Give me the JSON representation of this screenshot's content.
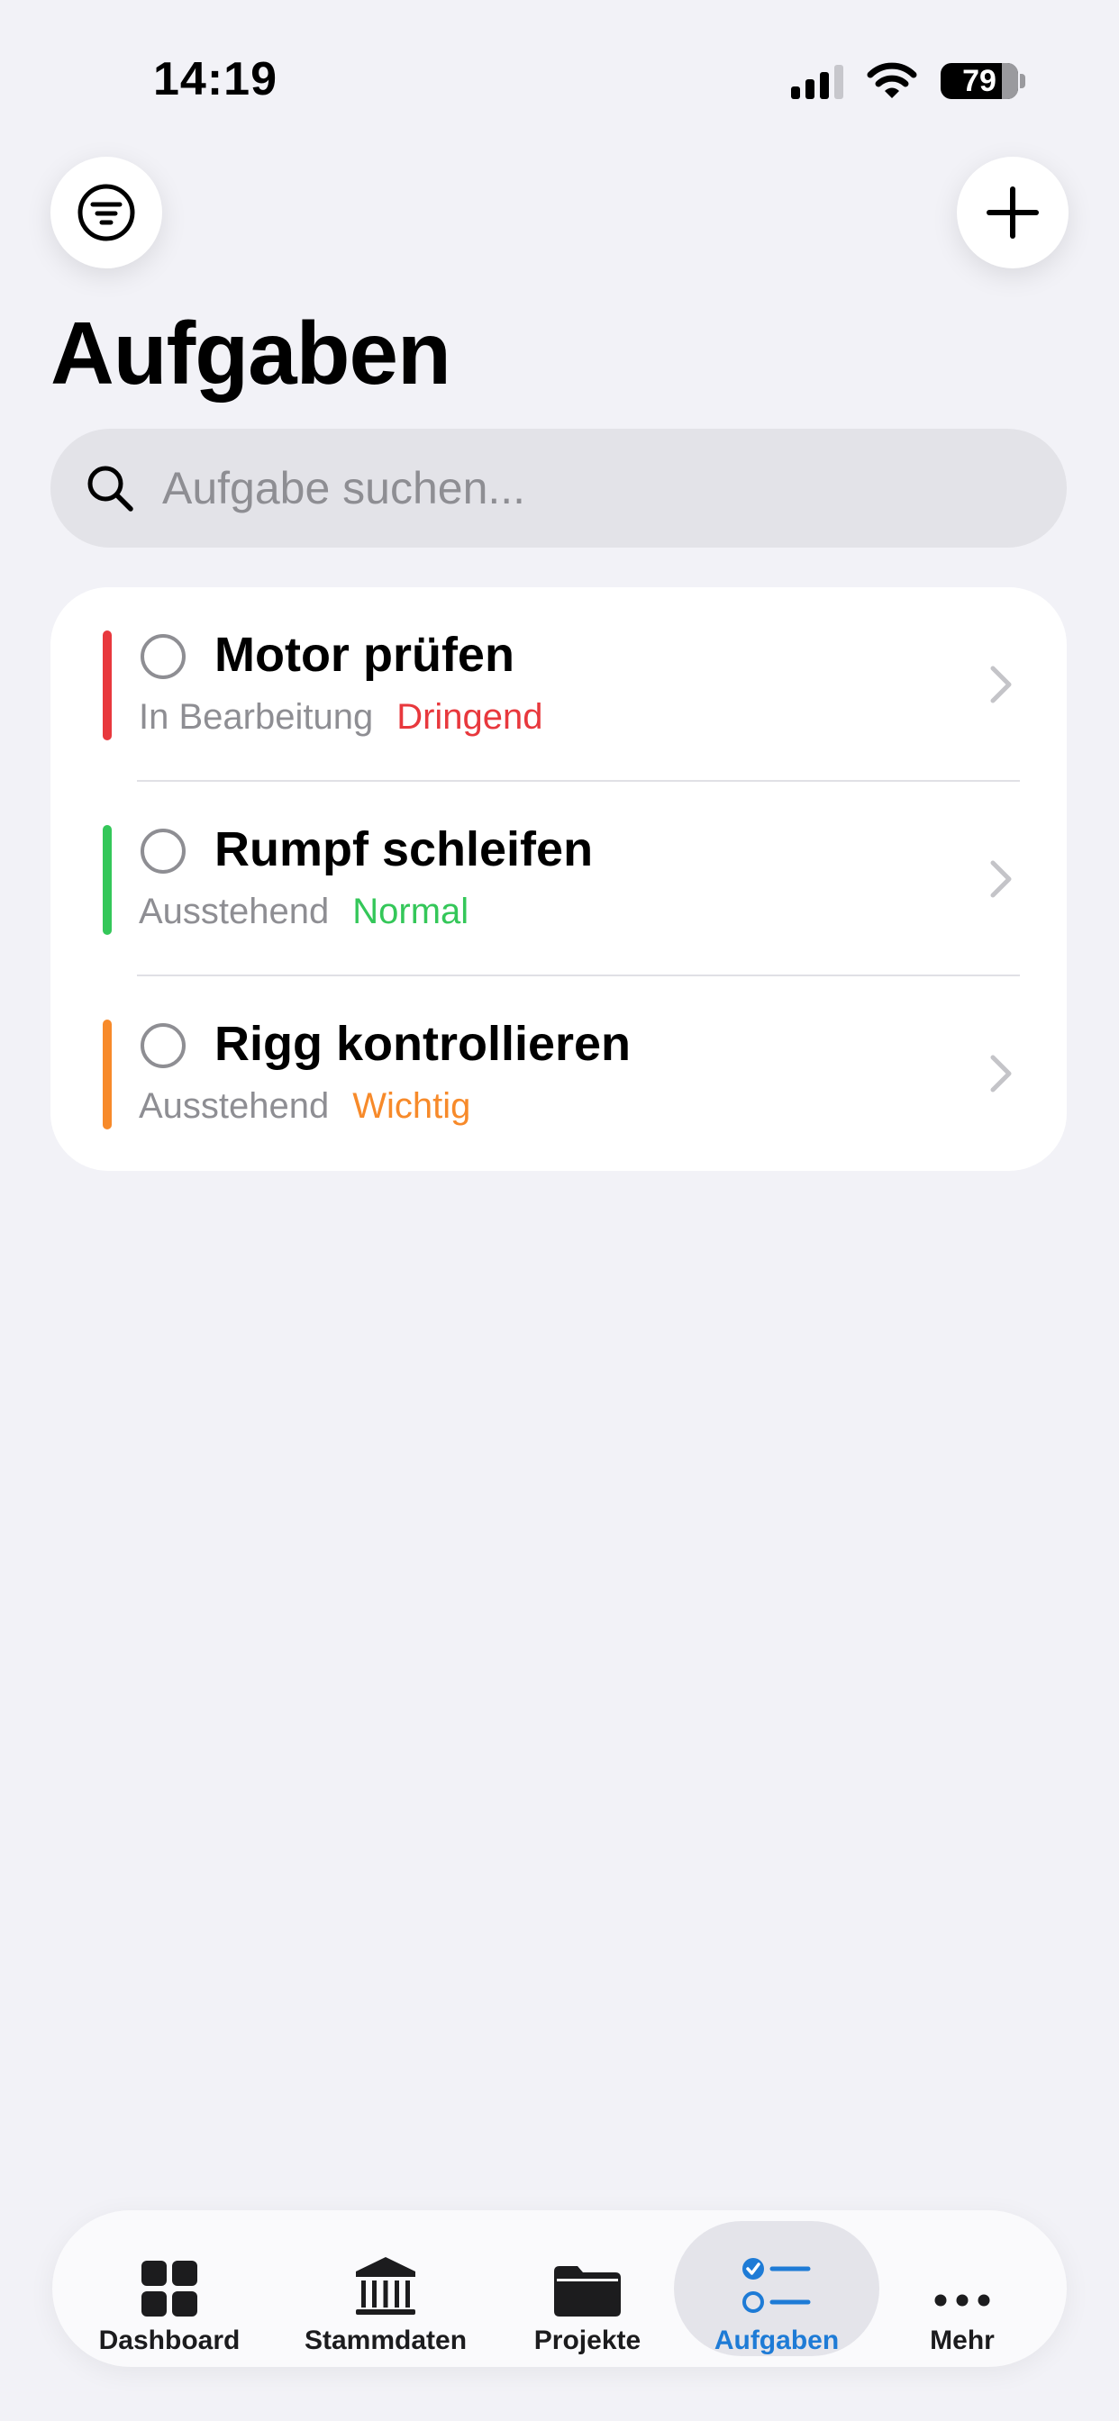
{
  "status_bar": {
    "time": "14:19",
    "battery": "79"
  },
  "header": {
    "title": "Aufgaben",
    "filter_icon": "line-3-horizontal-decrease-circle-icon",
    "add_icon": "plus-icon"
  },
  "search": {
    "placeholder": "Aufgabe suchen...",
    "value": ""
  },
  "tasks": [
    {
      "title": "Motor prüfen",
      "status": "In Bearbeitung",
      "priority": "Dringend",
      "priority_color": "#e8383d"
    },
    {
      "title": "Rumpf schleifen",
      "status": "Ausstehend",
      "priority": "Normal",
      "priority_color": "#34c759"
    },
    {
      "title": "Rigg kontrollieren",
      "status": "Ausstehend",
      "priority": "Wichtig",
      "priority_color": "#f78a2a"
    }
  ],
  "tabbar": {
    "active_color": "#1e7bd6",
    "items": [
      {
        "label": "Dashboard",
        "icon": "square-grid-2x2-icon"
      },
      {
        "label": "Stammdaten",
        "icon": "building-columns-icon"
      },
      {
        "label": "Projekte",
        "icon": "folder-icon"
      },
      {
        "label": "Aufgaben",
        "icon": "checklist-icon",
        "active": true
      },
      {
        "label": "Mehr",
        "icon": "ellipsis-icon"
      }
    ]
  }
}
